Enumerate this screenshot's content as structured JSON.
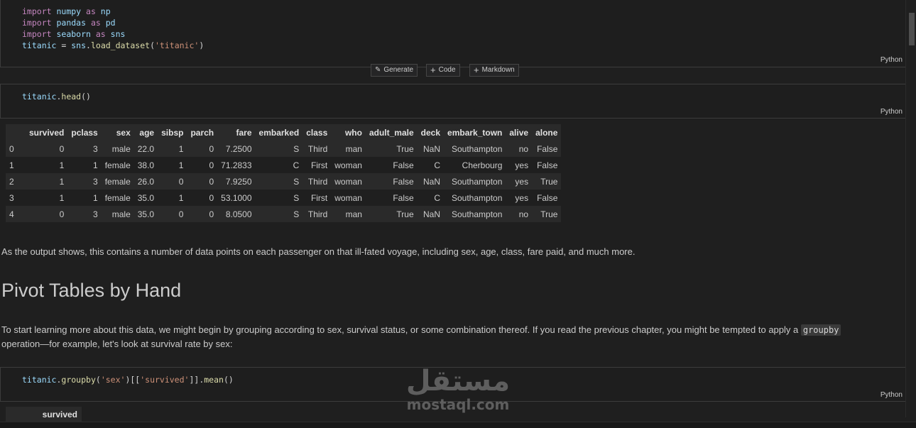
{
  "cell1": {
    "lines": [
      {
        "tokens": [
          {
            "t": "import",
            "c": "kw"
          },
          {
            "t": " numpy ",
            "c": "var"
          },
          {
            "t": "as",
            "c": "kw"
          },
          {
            "t": " np",
            "c": "var"
          }
        ]
      },
      {
        "tokens": [
          {
            "t": "import",
            "c": "kw"
          },
          {
            "t": " pandas ",
            "c": "var"
          },
          {
            "t": "as",
            "c": "kw"
          },
          {
            "t": " pd",
            "c": "var"
          }
        ]
      },
      {
        "tokens": [
          {
            "t": "import",
            "c": "kw"
          },
          {
            "t": " seaborn ",
            "c": "var"
          },
          {
            "t": "as",
            "c": "kw"
          },
          {
            "t": " sns",
            "c": "var"
          }
        ]
      },
      {
        "tokens": [
          {
            "t": "titanic",
            "c": "var"
          },
          {
            "t": " = ",
            "c": "plain"
          },
          {
            "t": "sns",
            "c": "var"
          },
          {
            "t": ".",
            "c": "plain"
          },
          {
            "t": "load_dataset",
            "c": "fn"
          },
          {
            "t": "(",
            "c": "plain"
          },
          {
            "t": "'titanic'",
            "c": "str"
          },
          {
            "t": ")",
            "c": "plain"
          }
        ]
      }
    ],
    "language": "Python"
  },
  "toolbar": {
    "generate_label": "Generate",
    "code_label": "Code",
    "markdown_label": "Markdown"
  },
  "cell2": {
    "lines": [
      {
        "tokens": [
          {
            "t": "titanic",
            "c": "var"
          },
          {
            "t": ".",
            "c": "plain"
          },
          {
            "t": "head",
            "c": "fn"
          },
          {
            "t": "()",
            "c": "plain"
          }
        ]
      }
    ],
    "language": "Python"
  },
  "output_table": {
    "columns": [
      "",
      "survived",
      "pclass",
      "sex",
      "age",
      "sibsp",
      "parch",
      "fare",
      "embarked",
      "class",
      "who",
      "adult_male",
      "deck",
      "embark_town",
      "alive",
      "alone"
    ],
    "rows": [
      [
        "0",
        "0",
        "3",
        "male",
        "22.0",
        "1",
        "0",
        "7.2500",
        "S",
        "Third",
        "man",
        "True",
        "NaN",
        "Southampton",
        "no",
        "False"
      ],
      [
        "1",
        "1",
        "1",
        "female",
        "38.0",
        "1",
        "0",
        "71.2833",
        "C",
        "First",
        "woman",
        "False",
        "C",
        "Cherbourg",
        "yes",
        "False"
      ],
      [
        "2",
        "1",
        "3",
        "female",
        "26.0",
        "0",
        "0",
        "7.9250",
        "S",
        "Third",
        "woman",
        "False",
        "NaN",
        "Southampton",
        "yes",
        "True"
      ],
      [
        "3",
        "1",
        "1",
        "female",
        "35.0",
        "1",
        "0",
        "53.1000",
        "S",
        "First",
        "woman",
        "False",
        "C",
        "Southampton",
        "yes",
        "False"
      ],
      [
        "4",
        "0",
        "3",
        "male",
        "35.0",
        "0",
        "0",
        "8.0500",
        "S",
        "Third",
        "man",
        "True",
        "NaN",
        "Southampton",
        "no",
        "True"
      ]
    ]
  },
  "markdown": {
    "para1": "As the output shows, this contains a number of data points on each passenger on that ill-fated voyage, including sex, age, class, fare paid, and much more.",
    "heading": "Pivot Tables by Hand",
    "para2_before": "To start learning more about this data, we might begin by grouping according to sex, survival status, or some combination thereof. If you read the previous chapter, you might be tempted to apply a ",
    "para2_code": "groupby",
    "para2_after": "operation—for example, let's look at survival rate by sex:"
  },
  "cell3": {
    "lines": [
      {
        "tokens": [
          {
            "t": "titanic",
            "c": "var"
          },
          {
            "t": ".",
            "c": "plain"
          },
          {
            "t": "groupby",
            "c": "fn"
          },
          {
            "t": "(",
            "c": "plain"
          },
          {
            "t": "'sex'",
            "c": "str"
          },
          {
            "t": ")[[",
            "c": "plain"
          },
          {
            "t": "'survived'",
            "c": "str"
          },
          {
            "t": "]].",
            "c": "plain"
          },
          {
            "t": "mean",
            "c": "fn"
          },
          {
            "t": "()",
            "c": "plain"
          }
        ]
      }
    ],
    "language": "Python"
  },
  "output2_header": "survived",
  "watermark": {
    "arabic": "مستقل",
    "latin": "mostaql.com"
  },
  "icons": [
    "sparkle-icon",
    "plus-icon",
    "plus-icon"
  ]
}
